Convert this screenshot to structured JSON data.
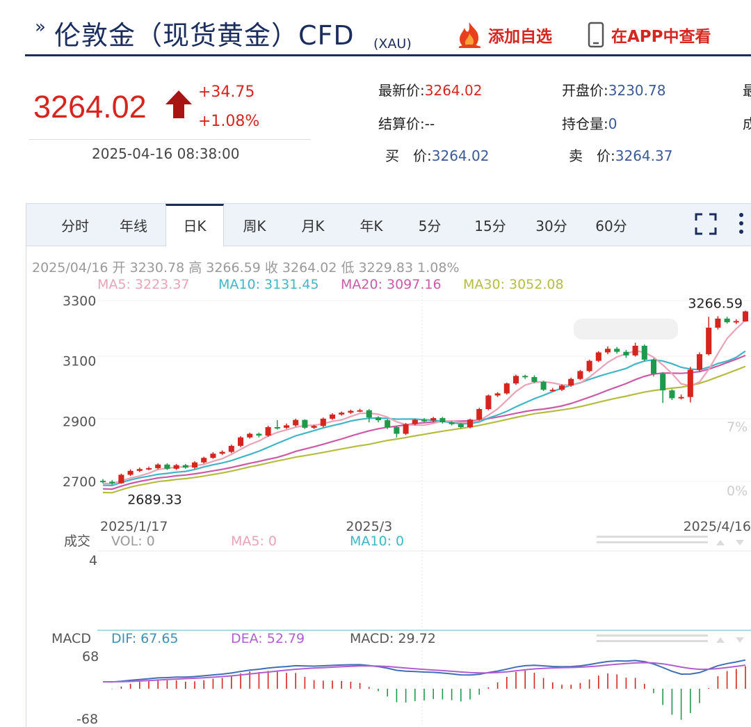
{
  "header": {
    "title_mark": "»",
    "title": "伦敦金（现货黄金）CFD",
    "title_sub": "(XAU)",
    "watch_label": "添加自选",
    "app_label": "在APP中查看"
  },
  "price_block": {
    "price": "3264.02",
    "change": "+34.75",
    "change_pct": "+1.08%",
    "timestamp": "2025-04-16 08:38:00"
  },
  "quote": {
    "latest_label": "最新价:",
    "latest_value": "3264.02",
    "open_label": "开盘价:",
    "open_value": "3230.78",
    "settle_label": "结算价:",
    "settle_value": "--",
    "oi_label": "持仓量:",
    "oi_value": "0",
    "bid_label": "买　价:",
    "bid_value": "3264.02",
    "ask_label": "卖　价:",
    "ask_value": "3264.37",
    "cut_a": "最",
    "cut_b": "成"
  },
  "tabs": [
    {
      "label": "分时"
    },
    {
      "label": "年线"
    },
    {
      "label": "日K"
    },
    {
      "label": "周K"
    },
    {
      "label": "月K"
    },
    {
      "label": "年K"
    },
    {
      "label": "5分"
    },
    {
      "label": "15分"
    },
    {
      "label": "30分"
    },
    {
      "label": "60分"
    }
  ],
  "active_tab": "日K",
  "info_line": "2025/04/16 开 3230.78 高 3266.59 收 3264.02 低 3229.83 1.08%",
  "ma_legend": {
    "ma5": "MA5: 3223.37",
    "ma10": "MA10: 3131.45",
    "ma20": "MA20: 3097.16",
    "ma30": "MA30: 3052.08"
  },
  "volume_legend": {
    "title": "成交",
    "vol": "VOL: 0",
    "ma5": "MA5: 0",
    "ma10": "MA10: 0",
    "axis_top": "4"
  },
  "macd_legend": {
    "title": "MACD",
    "dif": "DIF: 67.65",
    "dea": "DEA: 52.79",
    "macd": "MACD: 29.72",
    "axis_top": "68",
    "axis_bottom": "-68"
  },
  "watermarks": [
    "7%",
    "0%"
  ],
  "colors": {
    "up": "#d6251e",
    "down": "#1f9a4c",
    "ma5": "#e9a3b6",
    "ma10": "#3fb6c8",
    "ma20": "#cc5aa6",
    "ma30": "#b6bd3e",
    "navy": "#1a2d5c"
  },
  "chart_data": {
    "type": "candlestick",
    "y_ticks": [
      2700,
      2900,
      3100,
      3300
    ],
    "ylim": [
      2650,
      3320
    ],
    "x_labels": [
      "2025/1/17",
      "2025/3",
      "2025/4/16"
    ],
    "x_label_index": [
      0,
      29,
      58
    ],
    "annotations": [
      {
        "text": "2689.33",
        "index": 1,
        "value": 2689.33
      },
      {
        "text": "3266.59",
        "index": 58,
        "value": 3266.59
      }
    ],
    "candles": [
      [
        2702,
        2698,
        2708,
        2694
      ],
      [
        2699,
        2694,
        2704,
        2689.33
      ],
      [
        2694,
        2722,
        2726,
        2692
      ],
      [
        2722,
        2735,
        2740,
        2718
      ],
      [
        2735,
        2741,
        2746,
        2731
      ],
      [
        2741,
        2744,
        2749,
        2737
      ],
      [
        2744,
        2756,
        2760,
        2740
      ],
      [
        2756,
        2742,
        2760,
        2738
      ],
      [
        2742,
        2754,
        2758,
        2738
      ],
      [
        2754,
        2746,
        2758,
        2742
      ],
      [
        2746,
        2763,
        2767,
        2742
      ],
      [
        2763,
        2778,
        2782,
        2759
      ],
      [
        2778,
        2792,
        2797,
        2775
      ],
      [
        2792,
        2798,
        2803,
        2788
      ],
      [
        2798,
        2818,
        2822,
        2794
      ],
      [
        2818,
        2846,
        2850,
        2814
      ],
      [
        2846,
        2858,
        2862,
        2842
      ],
      [
        2858,
        2852,
        2862,
        2846
      ],
      [
        2852,
        2880,
        2885,
        2848
      ],
      [
        2880,
        2878,
        2903,
        2872
      ],
      [
        2878,
        2886,
        2892,
        2874
      ],
      [
        2886,
        2904,
        2908,
        2882
      ],
      [
        2904,
        2878,
        2906,
        2874
      ],
      [
        2878,
        2884,
        2888,
        2874
      ],
      [
        2884,
        2908,
        2912,
        2880
      ],
      [
        2908,
        2922,
        2926,
        2904
      ],
      [
        2922,
        2928,
        2932,
        2918
      ],
      [
        2928,
        2934,
        2938,
        2924
      ],
      [
        2934,
        2936,
        2941,
        2930
      ],
      [
        2936,
        2912,
        2940,
        2896
      ],
      [
        2912,
        2903,
        2916,
        2896
      ],
      [
        2903,
        2880,
        2906,
        2874
      ],
      [
        2880,
        2858,
        2884,
        2846
      ],
      [
        2858,
        2890,
        2894,
        2854
      ],
      [
        2890,
        2904,
        2908,
        2886
      ],
      [
        2904,
        2902,
        2910,
        2896
      ],
      [
        2902,
        2910,
        2914,
        2896
      ],
      [
        2910,
        2896,
        2914,
        2892
      ],
      [
        2896,
        2890,
        2900,
        2886
      ],
      [
        2890,
        2880,
        2894,
        2876
      ],
      [
        2880,
        2905,
        2908,
        2876
      ],
      [
        2905,
        2940,
        2944,
        2902
      ],
      [
        2940,
        2985,
        2988,
        2936
      ],
      [
        2985,
        2992,
        2996,
        2980
      ],
      [
        2992,
        3025,
        3028,
        2988
      ],
      [
        3025,
        3050,
        3054,
        3020
      ],
      [
        3050,
        3046,
        3054,
        3040
      ],
      [
        3046,
        3030,
        3052,
        3026
      ],
      [
        3030,
        3004,
        3034,
        3000
      ],
      [
        3004,
        3004,
        3010,
        2998
      ],
      [
        3004,
        3018,
        3022,
        3000
      ],
      [
        3018,
        3040,
        3044,
        3014
      ],
      [
        3040,
        3066,
        3070,
        3036
      ],
      [
        3066,
        3100,
        3104,
        3062
      ],
      [
        3100,
        3128,
        3132,
        3096
      ],
      [
        3128,
        3140,
        3148,
        3122
      ],
      [
        3140,
        3130,
        3146,
        3124
      ],
      [
        3130,
        3118,
        3136,
        3110
      ],
      [
        3118,
        3150,
        3160,
        3114
      ],
      [
        3150,
        3104,
        3154,
        3098
      ],
      [
        3104,
        3057,
        3108,
        3048
      ],
      [
        3057,
        3002,
        3062,
        2960
      ],
      [
        3002,
        2976,
        3006,
        2970
      ],
      [
        2976,
        2980,
        2988,
        2972
      ],
      [
        2980,
        3070,
        3080,
        2962
      ],
      [
        3070,
        3122,
        3128,
        3064
      ],
      [
        3122,
        3210,
        3246,
        3118
      ],
      [
        3210,
        3240,
        3248,
        3204
      ],
      [
        3240,
        3228,
        3246,
        3224
      ],
      [
        3228,
        3232,
        3238,
        3222
      ],
      [
        3230.78,
        3264.02,
        3266.59,
        3229.83
      ]
    ],
    "ma_series": [
      {
        "name": "MA5"
      },
      {
        "name": "MA10"
      },
      {
        "name": "MA20"
      },
      {
        "name": "MA30"
      }
    ]
  }
}
